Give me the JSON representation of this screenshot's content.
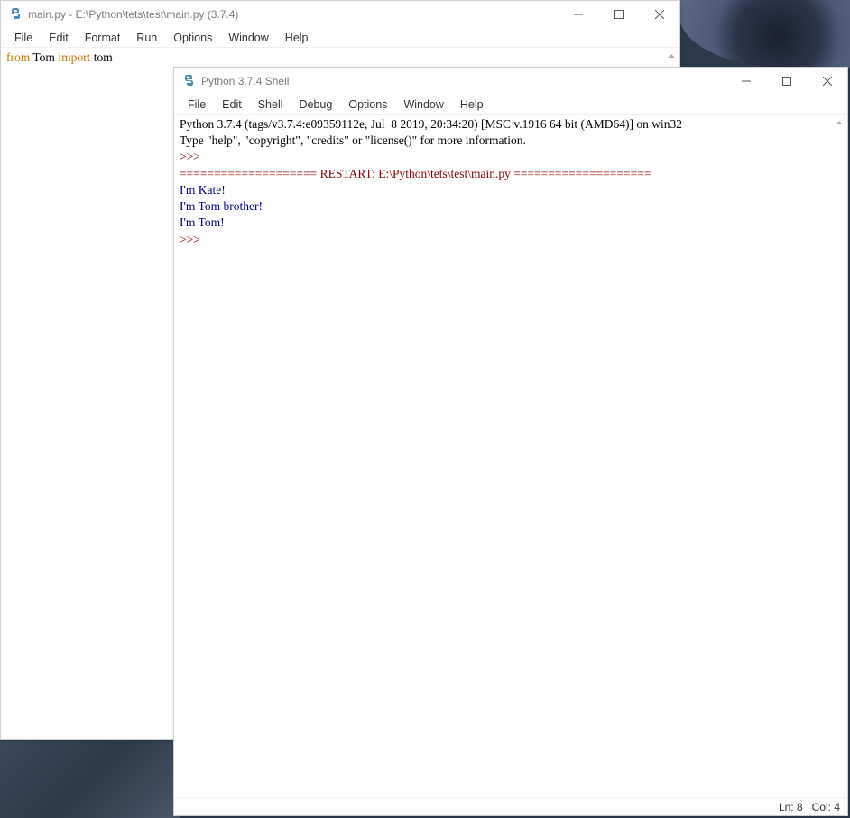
{
  "editor": {
    "title": "main.py - E:\\Python\\tets\\test\\main.py (3.7.4)",
    "menu": {
      "file": "File",
      "edit": "Edit",
      "format": "Format",
      "run": "Run",
      "options": "Options",
      "window": "Window",
      "help": "Help"
    },
    "code": {
      "kw_from": "from",
      "module": " Tom ",
      "kw_import": "import",
      "name": " tom"
    }
  },
  "shell": {
    "title": "Python 3.7.4 Shell",
    "menu": {
      "file": "File",
      "edit": "Edit",
      "shell": "Shell",
      "debug": "Debug",
      "options": "Options",
      "window": "Window",
      "help": "Help"
    },
    "banner_line1": "Python 3.7.4 (tags/v3.7.4:e09359112e, Jul  8 2019, 20:34:20) [MSC v.1916 64 bit (AMD64)] on win32",
    "banner_line2": "Type \"help\", \"copyright\", \"credits\" or \"license()\" for more information.",
    "prompt": ">>> ",
    "restart_line": "==================== RESTART: E:\\Python\\tets\\test\\main.py ====================",
    "out1": "I'm Kate!",
    "out2": "I'm Tom brother!",
    "out3": "I'm Tom!",
    "status_ln": "Ln: 8",
    "status_col": "Col: 4"
  }
}
